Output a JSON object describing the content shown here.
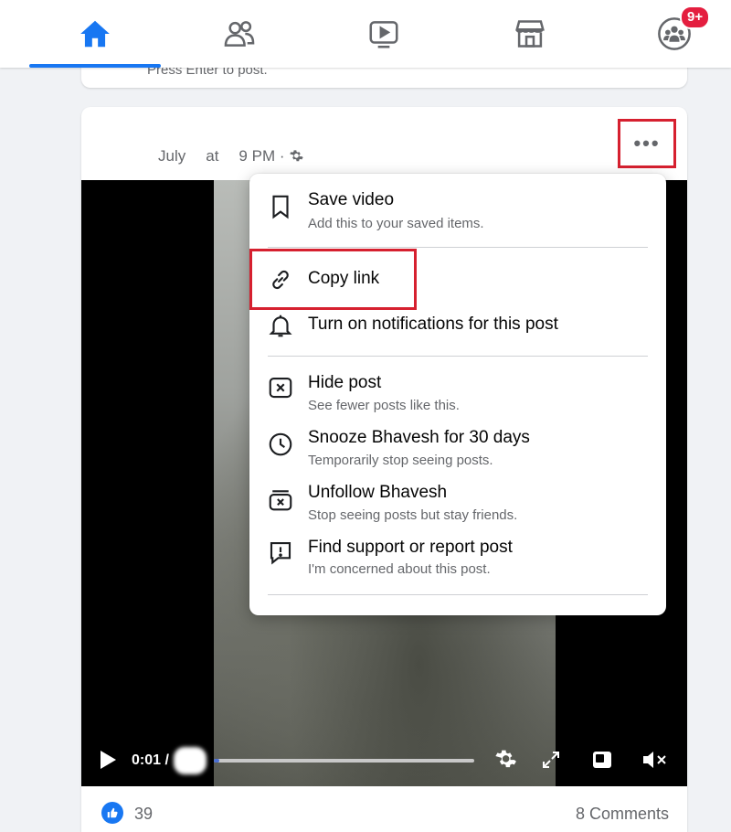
{
  "nav": {
    "items": [
      {
        "id": "home",
        "icon": "home-icon",
        "active": true
      },
      {
        "id": "friends",
        "icon": "friends-icon"
      },
      {
        "id": "watch",
        "icon": "video-play-icon"
      },
      {
        "id": "marketplace",
        "icon": "marketplace-icon"
      },
      {
        "id": "groups",
        "icon": "groups-icon",
        "badge": "9+"
      }
    ],
    "accent": "#1877f2",
    "badge_color": "#e41e3f"
  },
  "composer": {
    "hint": "Press Enter to post."
  },
  "post": {
    "meta_month": "July",
    "meta_at": "at",
    "meta_time": "9 PM ·",
    "privacy_icon": "gear-icon",
    "video": {
      "time_current": "0:01 /",
      "progress_fraction": 0.02
    },
    "footer": {
      "likes": "39",
      "comments": "8 Comments"
    }
  },
  "menu": {
    "items": [
      {
        "icon": "bookmark-icon",
        "title": "Save video",
        "subtitle": "Add this to your saved items."
      },
      {
        "icon": "link-icon",
        "title": "Copy link"
      },
      {
        "icon": "bell-icon",
        "title": "Turn on notifications for this post"
      },
      {
        "icon": "hide-icon",
        "title": "Hide post",
        "subtitle": "See fewer posts like this."
      },
      {
        "icon": "clock-icon",
        "title": "Snooze Bhavesh for 30 days",
        "subtitle": "Temporarily stop seeing posts."
      },
      {
        "icon": "unfollow-icon",
        "title": "Unfollow Bhavesh",
        "subtitle": "Stop seeing posts but stay friends."
      },
      {
        "icon": "report-icon",
        "title": "Find support or report post",
        "subtitle": "I'm concerned about this post."
      }
    ],
    "highlight_color": "#d6202f"
  }
}
